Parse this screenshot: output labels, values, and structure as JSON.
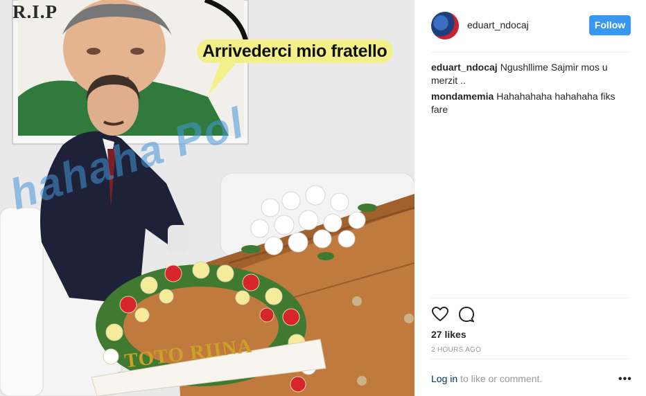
{
  "photo": {
    "rip_text": "R.I.P",
    "bubble_text": "Arrivederci mio fratello",
    "watermark_text": "hahaha Pol",
    "ribbon_text": "TOTO RIINA"
  },
  "post": {
    "username": "eduart_ndocaj",
    "follow_label": "Follow",
    "comments": [
      {
        "user": "eduart_ndocaj",
        "text": "Ngushllime Sajmir mos u merzit .."
      },
      {
        "user": "mondamemia",
        "text": "Hahahahaha hahahaha fiks fare"
      }
    ],
    "likes": "27 likes",
    "time": "2 HOURS AGO",
    "login_link": "Log in",
    "login_rest": "to like or comment.",
    "more": "•••"
  },
  "colors": {
    "follow_bg": "#3897f0",
    "link": "#003569",
    "bubble": "#f3f08a"
  },
  "icons": [
    "heart-icon",
    "comment-icon",
    "more-options-icon"
  ]
}
